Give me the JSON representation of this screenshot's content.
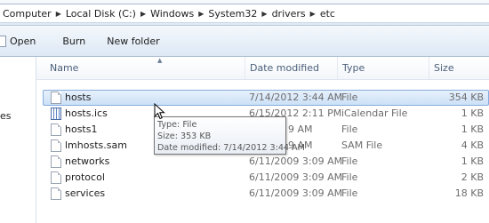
{
  "address": {
    "crumbs": [
      "Computer",
      "Local Disk (C:)",
      "Windows",
      "System32",
      "drivers",
      "etc"
    ]
  },
  "toolbar": {
    "open_label": "Open",
    "burn_label": "Burn",
    "new_folder_label": "New folder"
  },
  "nav": {
    "fragment": "es"
  },
  "columns": {
    "name": "Name",
    "date": "Date modified",
    "type": "Type",
    "size": "Size"
  },
  "files": [
    {
      "name": "hosts",
      "date": "7/14/2012 3:44 AM",
      "type": "File",
      "size": "354 KB",
      "icon": "file-icon"
    },
    {
      "name": "hosts.ics",
      "date": "6/15/2012 2:11 PM",
      "type": "iCalendar File",
      "size": "1 KB",
      "icon": "calendar-file-icon"
    },
    {
      "name": "hosts1",
      "date": "9 AM",
      "type": "File",
      "size": "1 KB",
      "icon": "file-icon"
    },
    {
      "name": "lmhosts.sam",
      "date": "9 AM",
      "type": "SAM File",
      "size": "4 KB",
      "icon": "file-icon"
    },
    {
      "name": "networks",
      "date": "6/11/2009 3:09 AM",
      "type": "File",
      "size": "1 KB",
      "icon": "file-icon"
    },
    {
      "name": "protocol",
      "date": "6/11/2009 3:09 AM",
      "type": "File",
      "size": "2 KB",
      "icon": "file-icon"
    },
    {
      "name": "services",
      "date": "6/11/2009 3:09 AM",
      "type": "File",
      "size": "18 KB",
      "icon": "file-icon"
    }
  ],
  "tooltip": {
    "type_line": "Type: File",
    "size_line": "Size: 353 KB",
    "date_line": "Date modified: 7/14/2012 3:44 AM"
  },
  "colors": {
    "selection": "#cce1f7",
    "selection_border": "#84acdd",
    "header_text": "#4c607a",
    "secondary_text": "#6d6d6d"
  }
}
